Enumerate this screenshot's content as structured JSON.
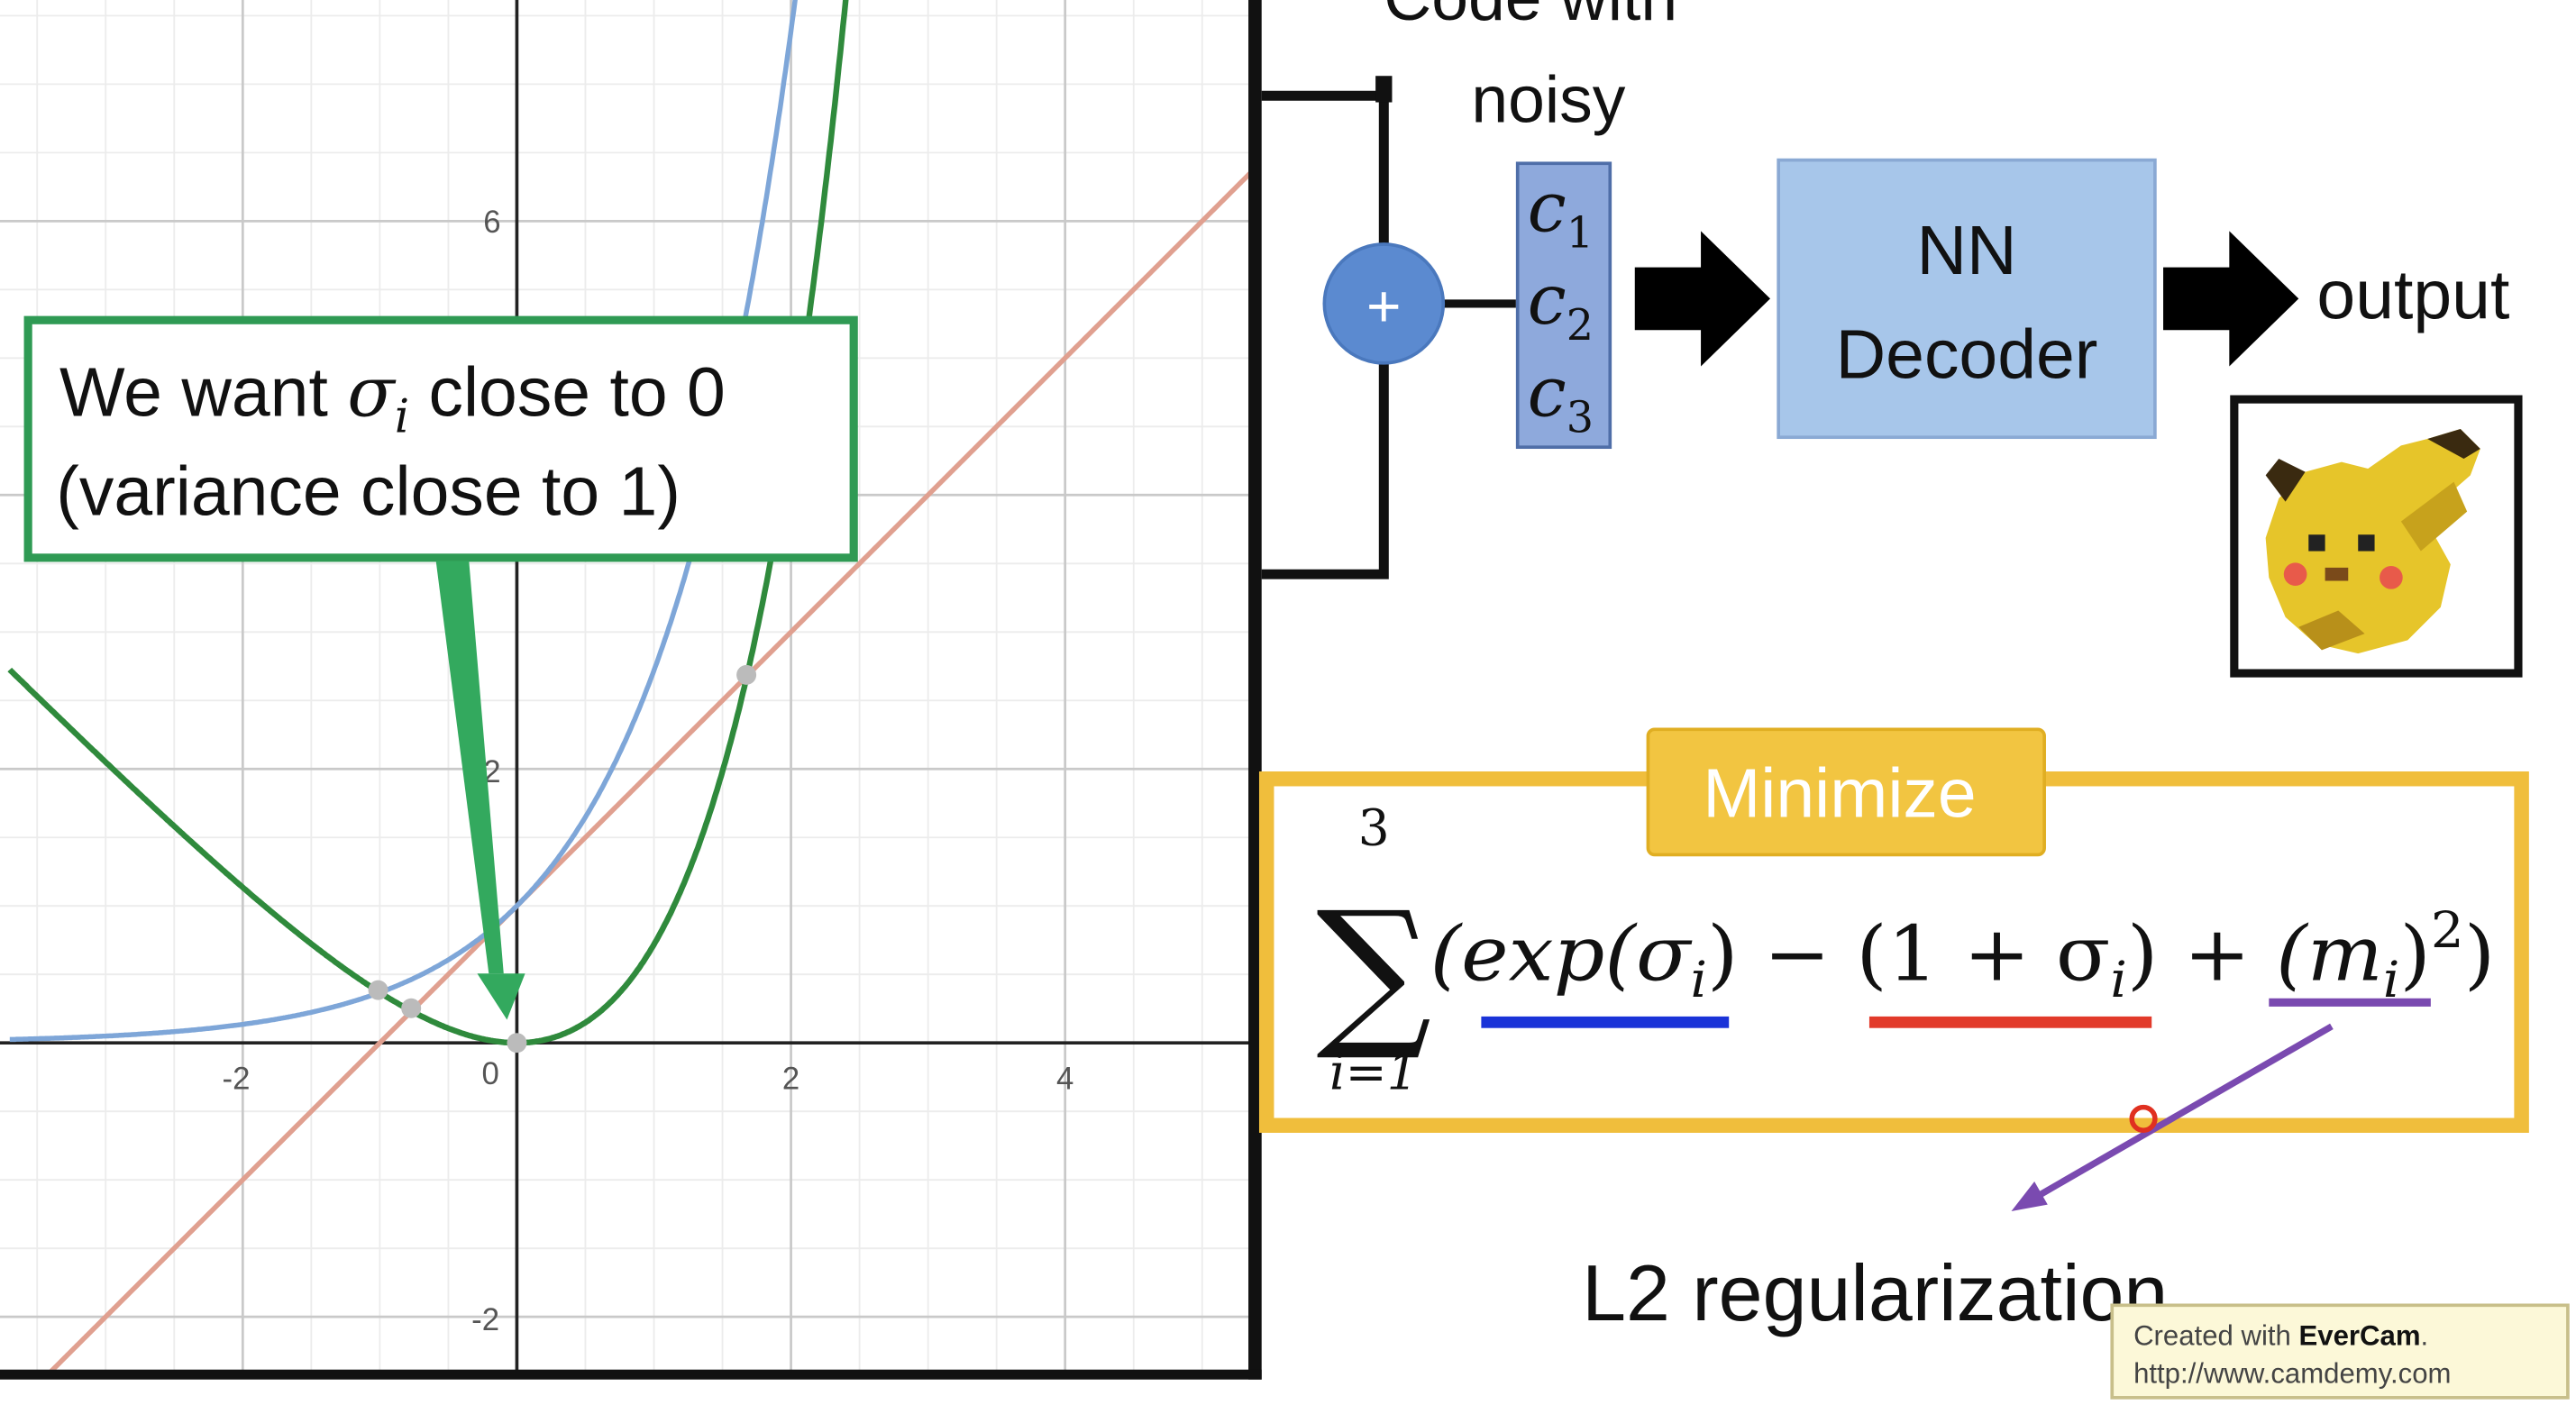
{
  "graph": {
    "x_ticks": [
      "-2",
      "0",
      "2",
      "4"
    ],
    "y_ticks": [
      "6",
      "2",
      "-2"
    ],
    "annotation_line1_prefix": "We want ",
    "annotation_sigma": "σ",
    "annotation_sub": "i",
    "annotation_line1_suffix": " close to 0",
    "annotation_line2": "(variance close to 1)",
    "curves": [
      {
        "name": "exp",
        "color": "#7ea6d8"
      },
      {
        "name": "1+x",
        "color": "#e0a090"
      },
      {
        "name": "exp-(1+x)",
        "color": "#2f8a3c"
      }
    ],
    "x_range": [
      -3.7,
      5.4
    ],
    "y_range": [
      -2.4,
      7.6
    ]
  },
  "diagram": {
    "top_label_cut": "Code with",
    "top_label": "noisy",
    "plus": "+",
    "code_letter": "c",
    "code_subs": [
      "1",
      "2",
      "3"
    ],
    "decoder_line1": "NN",
    "decoder_line2": "Decoder",
    "output": "output"
  },
  "minimize": {
    "label": "Minimize",
    "sum_top": "3",
    "sum_bottom": "i=1",
    "sum_symbol": "∑",
    "term_exp": "(exp(σ",
    "sub_i": "i",
    "term_exp_close": ")",
    "minus": " − ",
    "term_one": "(1 + σ",
    "term_one_close": ")",
    "plus": " + ",
    "term_m": "(m",
    "term_m_close": ")",
    "sup2": "2",
    "final_paren": ")",
    "underline_colors": [
      "#1a33d8",
      "#e23a2a",
      "#7a4ab0"
    ]
  },
  "l2_label": "L2 regularization",
  "watermark": {
    "prefix": "Created with ",
    "brand": "EverCam",
    "suffix": ".",
    "url": "http://www.camdemy.com"
  }
}
